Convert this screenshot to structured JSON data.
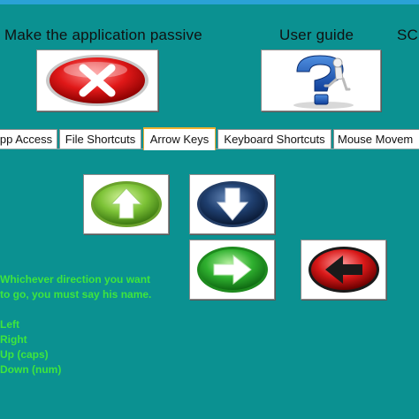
{
  "top": {
    "passive_title": "Make the application passive",
    "guide_title": "User guide",
    "cut_title": "SC"
  },
  "tabs": [
    {
      "label": "pp Access"
    },
    {
      "label": "File Shortcuts"
    },
    {
      "label": "Arrow Keys",
      "active": true
    },
    {
      "label": "Keyboard Shortcuts"
    },
    {
      "label": "Mouse Movem"
    }
  ],
  "arrows": {
    "up": "arrow-up-icon",
    "down": "arrow-down-icon",
    "right": "arrow-right-icon",
    "left": "arrow-left-icon"
  },
  "instructions": {
    "line1": "Whichever direction you want",
    "line2": "to go, you must say his name.",
    "commands": [
      "Left",
      "Right",
      "Up (caps)",
      "Down (num)"
    ]
  },
  "colors": {
    "background": "#0b9191",
    "instruction_text": "#3ee63e",
    "active_tab_border": "#f0b030"
  }
}
